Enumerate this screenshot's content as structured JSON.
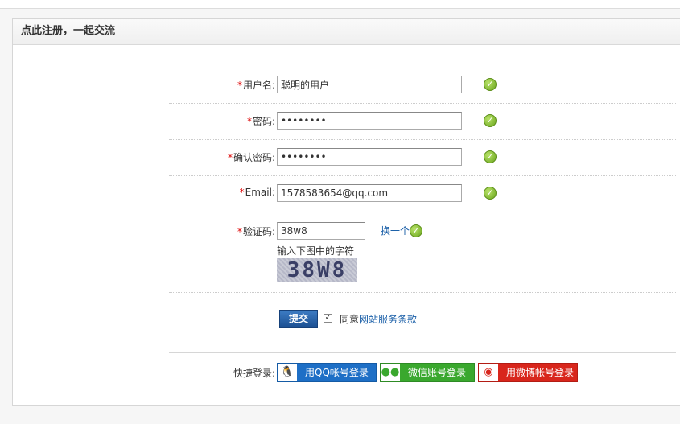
{
  "panel": {
    "title": "点此注册，一起交流"
  },
  "form": {
    "username": {
      "required": "*",
      "label": "用户名:",
      "value": "聪明的用户",
      "status_icon": "check-icon"
    },
    "password": {
      "required": "*",
      "label": "密码:",
      "value": "••••••••",
      "status_icon": "check-icon"
    },
    "confirm_password": {
      "required": "*",
      "label": "确认密码:",
      "value": "••••••••",
      "status_icon": "check-icon"
    },
    "email": {
      "required": "*",
      "label": "Email:",
      "value": "1578583654@qq.com",
      "status_icon": "check-icon"
    },
    "captcha": {
      "required": "*",
      "label": "验证码:",
      "value": "38w8",
      "refresh_label": "换一个",
      "hint": "输入下图中的字符",
      "image_text": "38W8",
      "status_icon": "check-icon"
    }
  },
  "submit": {
    "label": "提交",
    "agree_prefix": "同意",
    "agree_link": "网站服务条款",
    "agree_checked": true
  },
  "quick_login": {
    "label": "快捷登录:",
    "qq": {
      "label": "用QQ帐号登录",
      "icon": "penguin-icon",
      "color": "#1e6fc6"
    },
    "wechat": {
      "label": "微信账号登录",
      "icon": "wechat-icon",
      "color": "#3aa82e"
    },
    "weibo": {
      "label": "用微博帐号登录",
      "icon": "weibo-icon",
      "color": "#d8261c"
    }
  }
}
